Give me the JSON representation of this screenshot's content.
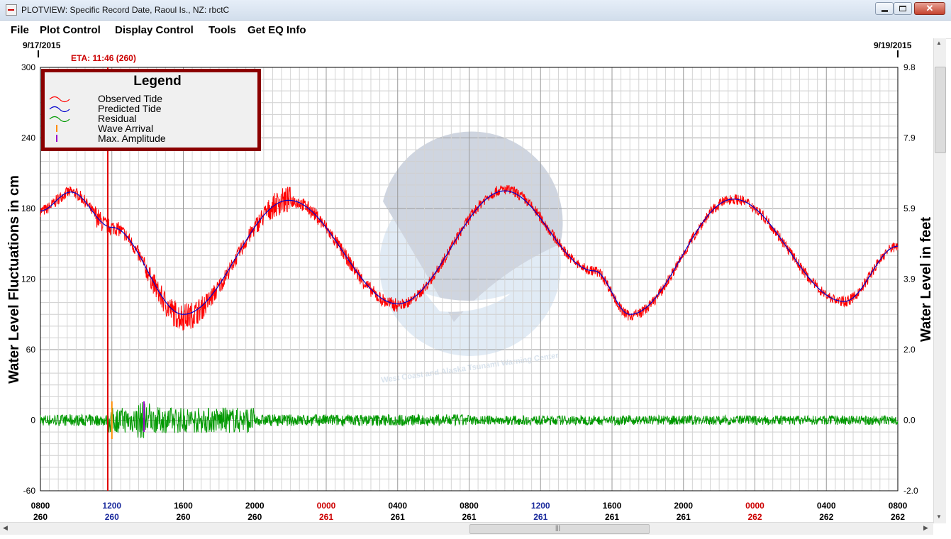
{
  "window": {
    "title": "PLOTVIEW: Specific Record Date, Raoul Is., NZ: rbctC",
    "icon": "plot-app-icon"
  },
  "menu": [
    "File",
    "Plot Control",
    "Display Control",
    "Tools",
    "Get EQ Info"
  ],
  "plot": {
    "date_start": "9/17/2015",
    "date_end": "9/19/2015",
    "eta_label": "ETA: 11:46 (260)",
    "left_axis_title": "Water Level Fluctuations in cm",
    "right_axis_title": "Water Level in feet",
    "left_ticks": [
      "300",
      "240",
      "180",
      "120",
      "60",
      "0",
      "-60"
    ],
    "right_ticks": [
      "9.8",
      "7.9",
      "5.9",
      "3.9",
      "2.0",
      "0.0",
      "-2.0"
    ],
    "time_ticks": [
      {
        "time": "0800",
        "day": "260",
        "color": "#000000"
      },
      {
        "time": "1200",
        "day": "260",
        "color": "#1a2a9c"
      },
      {
        "time": "1600",
        "day": "260",
        "color": "#000000"
      },
      {
        "time": "2000",
        "day": "260",
        "color": "#000000"
      },
      {
        "time": "0000",
        "day": "261",
        "color": "#cc0000"
      },
      {
        "time": "0400",
        "day": "261",
        "color": "#000000"
      },
      {
        "time": "0800",
        "day": "261",
        "color": "#000000"
      },
      {
        "time": "1200",
        "day": "261",
        "color": "#1a2a9c"
      },
      {
        "time": "1600",
        "day": "261",
        "color": "#000000"
      },
      {
        "time": "2000",
        "day": "261",
        "color": "#000000"
      },
      {
        "time": "0000",
        "day": "262",
        "color": "#cc0000"
      },
      {
        "time": "0400",
        "day": "262",
        "color": "#000000"
      },
      {
        "time": "0800",
        "day": "262",
        "color": "#000000"
      }
    ],
    "legend": {
      "title": "Legend",
      "items": [
        {
          "label": "Observed Tide",
          "color": "#ff0000",
          "kind": "wave"
        },
        {
          "label": "Predicted Tide",
          "color": "#0000cc",
          "kind": "wave"
        },
        {
          "label": "Residual",
          "color": "#009900",
          "kind": "wave"
        },
        {
          "label": "Wave Arrival",
          "color": "#ff8c00",
          "kind": "tick"
        },
        {
          "label": "Max. Amplitude",
          "color": "#9900cc",
          "kind": "tick"
        }
      ]
    },
    "watermark_text": "West Coast and Alaska Tsunami Warning Center",
    "colors": {
      "eta_line": "#e00000",
      "observed": "#ff0000",
      "predicted": "#0000cc",
      "residual": "#009900",
      "grid": "#bbbbbb",
      "legend_border": "#8b0000"
    }
  },
  "chart_data": {
    "type": "line",
    "x_unit": "hours from 0800 day 260",
    "xlim": [
      0,
      48
    ],
    "ylim": [
      -60,
      300
    ],
    "y2lim": [
      -2.0,
      9.8
    ],
    "grid": true,
    "legend_placement": "top-left",
    "eta_hour": 3.77,
    "wave_arrival_hour": 4.0,
    "max_amplitude_hour": 5.8,
    "series": [
      {
        "name": "Predicted Tide",
        "x": [
          0,
          1.7,
          4.0,
          8.0,
          13.9,
          20.0,
          26.0,
          31.0,
          33.0,
          38.8,
          45.0,
          48
        ],
        "values": [
          178,
          194,
          164,
          90,
          187,
          99,
          195,
          127,
          90,
          188,
          101,
          148
        ]
      },
      {
        "name": "Observed Tide",
        "x": [
          0,
          1.7,
          4.0,
          8.0,
          13.9,
          20.0,
          26.0,
          31.0,
          33.0,
          38.8,
          45.0,
          48
        ],
        "values": [
          178,
          194,
          164,
          88,
          187,
          98,
          196,
          127,
          89,
          188,
          101,
          148
        ]
      },
      {
        "name": "Residual",
        "x": [
          0,
          4.0,
          5.8,
          12.0,
          24.0,
          48
        ],
        "values": [
          0,
          0,
          0,
          0,
          0,
          0
        ]
      }
    ]
  }
}
